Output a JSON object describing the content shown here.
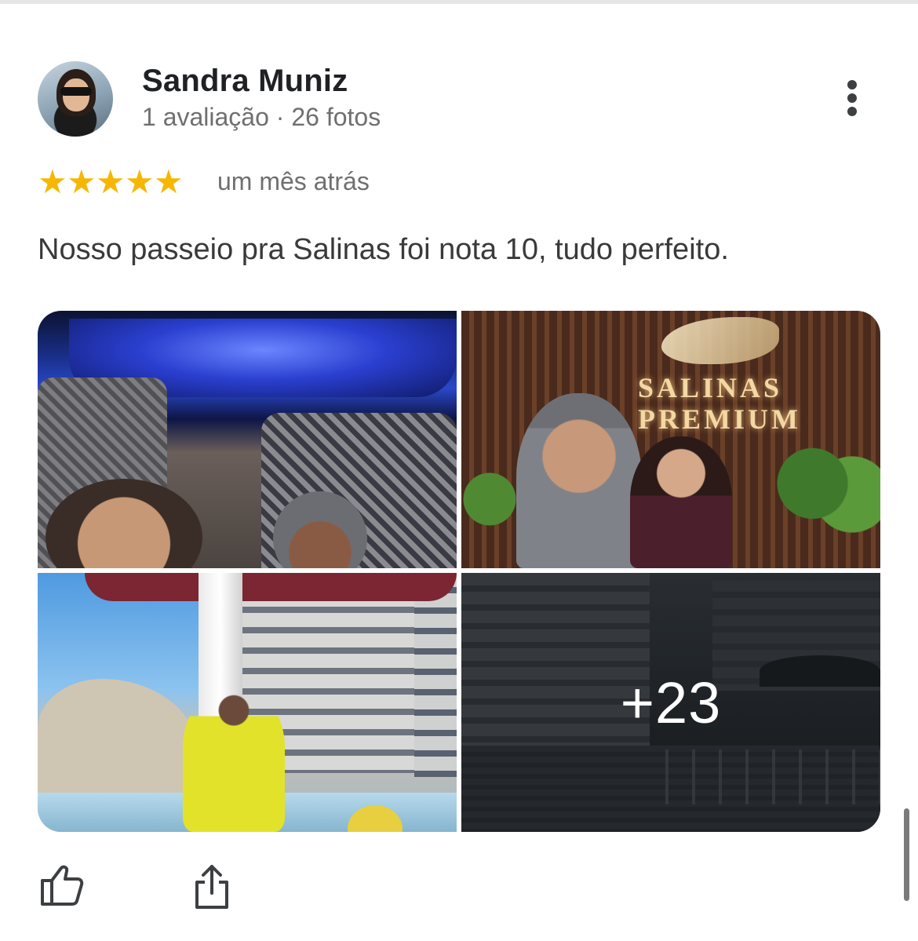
{
  "review": {
    "author": {
      "name": "Sandra Muniz",
      "meta": "1 avaliação · 26 fotos"
    },
    "rating": 5,
    "stars": [
      "★",
      "★",
      "★",
      "★",
      "★"
    ],
    "date": "um mês atrás",
    "text": "Nosso passeio pra Salinas foi nota 10, tudo perfeito.",
    "photos": {
      "logo_line1": "SALINAS",
      "logo_line2": "PREMIUM",
      "more_count": "+23"
    }
  },
  "icons": {
    "more": "more-vert-icon",
    "like": "thumb-up-icon",
    "share": "share-icon"
  },
  "colors": {
    "star": "#f6b704",
    "name": "#202124",
    "secondary": "#6f6f6f",
    "body_text": "#3a3a3a"
  }
}
